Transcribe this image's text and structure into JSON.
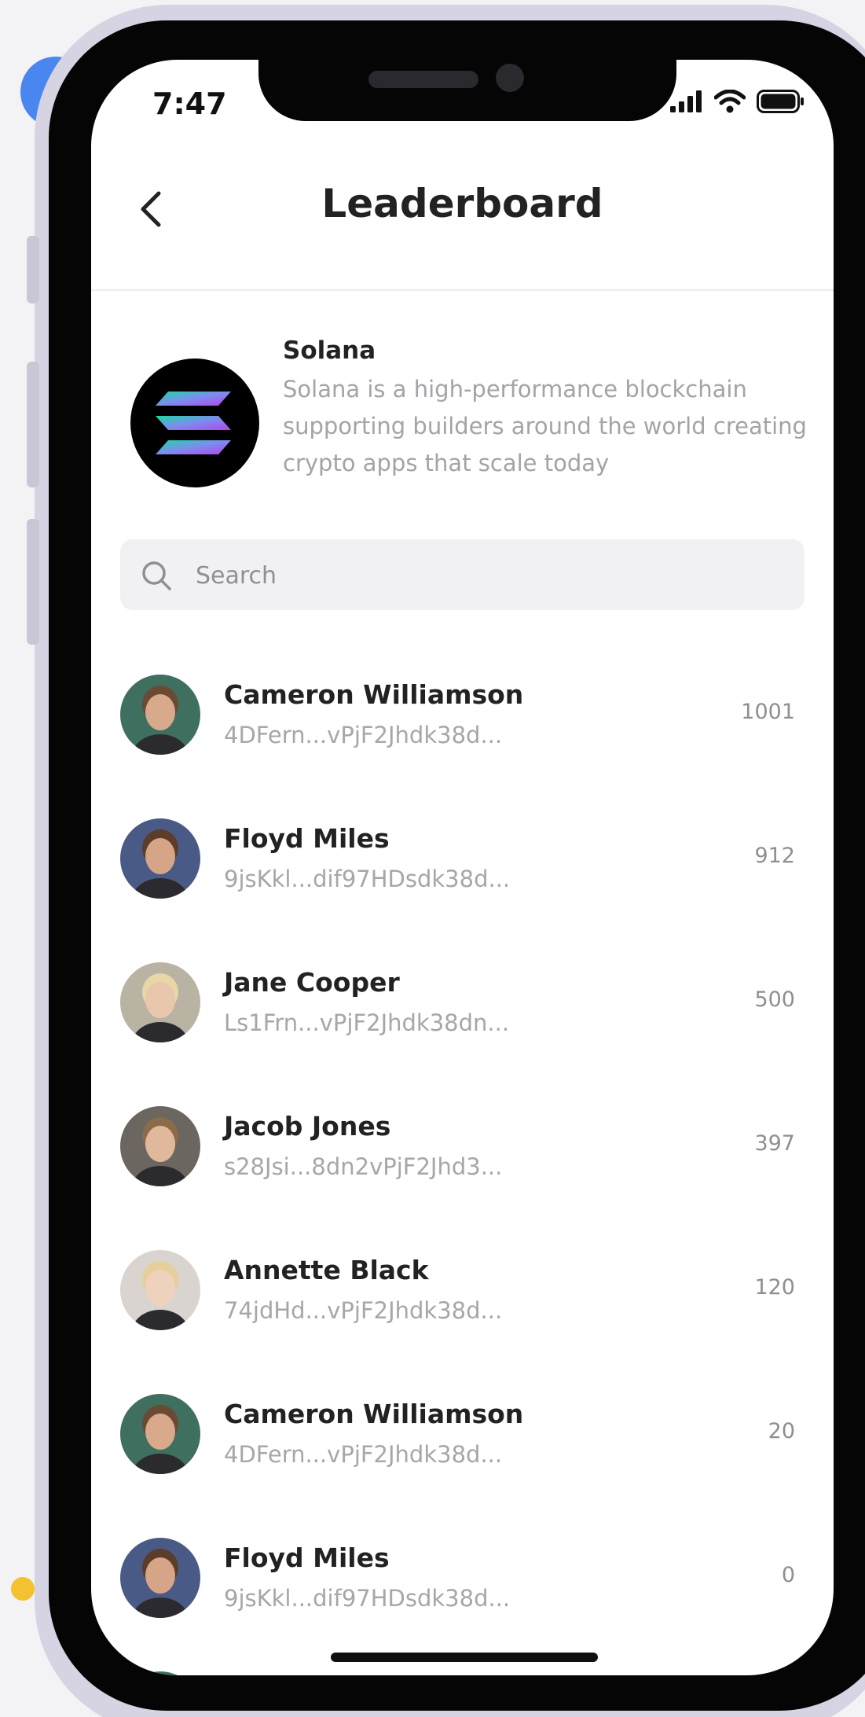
{
  "status_bar": {
    "time": "7:47"
  },
  "header": {
    "title": "Leaderboard"
  },
  "project": {
    "name": "Solana",
    "description": "Solana is a high-performance blockchain supporting builders around the world creating crypto apps that scale today",
    "logo_icon": "solana-logo",
    "logo_colors": [
      "#1bd9a4",
      "#7e8bf0",
      "#b146ea"
    ]
  },
  "search": {
    "placeholder": "Search",
    "value": ""
  },
  "leaderboard": [
    {
      "name": "Cameron Williamson",
      "address": "4DFern...vPjF2Jhdk38d...",
      "score": "1001",
      "avatar_color": "#3f6f5e",
      "skin": "#d9a98b",
      "hair": "#6b4a34"
    },
    {
      "name": "Floyd Miles",
      "address": "9jsKkl...dif97HDsdk38d...",
      "score": "912",
      "avatar_color": "#4a5a86",
      "skin": "#d6a487",
      "hair": "#5c3d2a"
    },
    {
      "name": "Jane Cooper",
      "address": "Ls1Frn...vPjF2Jhdk38dn...",
      "score": "500",
      "avatar_color": "#b9b3a4",
      "skin": "#e8c7ad",
      "hair": "#e8d5a8"
    },
    {
      "name": "Jacob Jones",
      "address": "s28Jsi...8dn2vPjF2Jhd3...",
      "score": "397",
      "avatar_color": "#6b6660",
      "skin": "#e0b89c",
      "hair": "#8a6c4a"
    },
    {
      "name": "Annette Black",
      "address": "74jdHd...vPjF2Jhdk38d...",
      "score": "120",
      "avatar_color": "#d9d4cf",
      "skin": "#efd2bd",
      "hair": "#e7cf9c"
    },
    {
      "name": "Cameron Williamson",
      "address": "4DFern...vPjF2Jhdk38d...",
      "score": "20",
      "avatar_color": "#3f6f5e",
      "skin": "#d9a98b",
      "hair": "#6b4a34"
    },
    {
      "name": "Floyd Miles",
      "address": "9jsKkl...dif97HDsdk38d...",
      "score": "0",
      "avatar_color": "#4a5a86",
      "skin": "#d6a487",
      "hair": "#5c3d2a"
    }
  ]
}
